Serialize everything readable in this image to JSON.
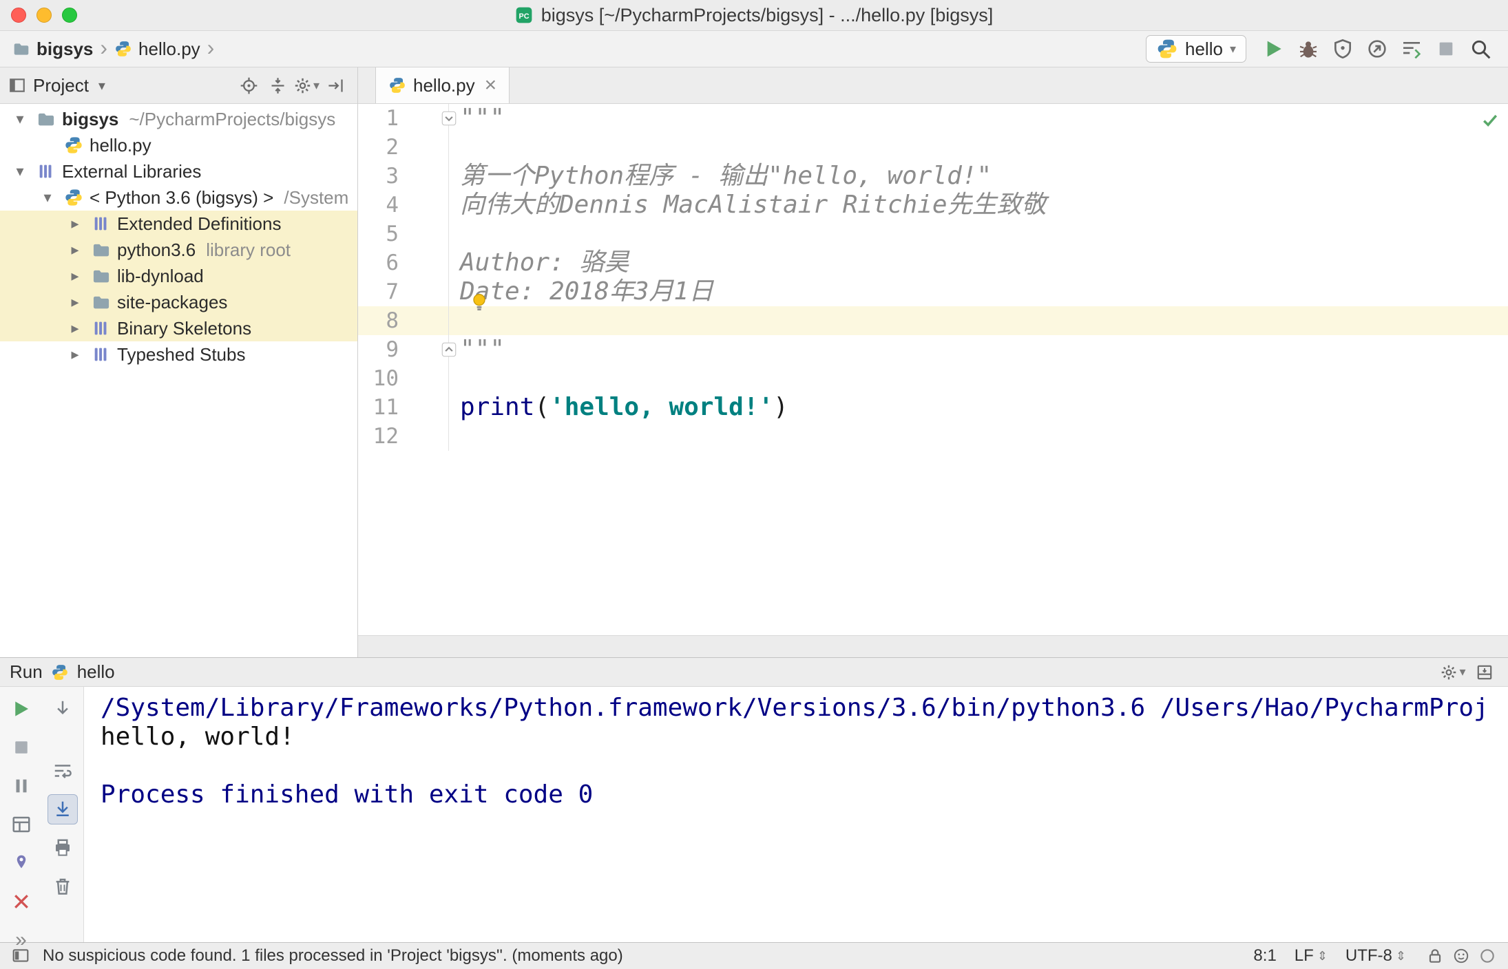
{
  "colors": {
    "accent_green": "#59a869",
    "console_system_blue": "#000084",
    "string_teal": "#008080",
    "keyword_blue": "#000080",
    "docstring_gray": "#8c8c8c",
    "highlight_yellow": "#f9f2cc",
    "python_blue": "#4584b6",
    "python_yellow": "#ffd43b"
  },
  "titlebar": {
    "title": "bigsys [~/PycharmProjects/bigsys] - .../hello.py [bigsys]",
    "app_icon": "pycharm"
  },
  "navbar": {
    "breadcrumbs": [
      {
        "label": "bigsys",
        "icon": "folder",
        "bold": true
      },
      {
        "label": "hello.py",
        "icon": "python",
        "bold": false
      }
    ],
    "run_config": {
      "label": "hello",
      "icon": "python"
    },
    "actions": [
      {
        "name": "run-button",
        "icon": "play"
      },
      {
        "name": "debug-button",
        "icon": "bug"
      },
      {
        "name": "run-with-coverage-button",
        "icon": "coverage"
      },
      {
        "name": "profiler-button",
        "icon": "profiler"
      },
      {
        "name": "thread-dump-button",
        "icon": "threads"
      },
      {
        "name": "stop-button",
        "icon": "stop"
      },
      {
        "name": "search-everywhere-button",
        "icon": "search"
      }
    ]
  },
  "project_panel": {
    "title": "Project",
    "tool_icon": "tool-window",
    "actions": [
      {
        "name": "locate-file-button",
        "icon": "target"
      },
      {
        "name": "collapse-all-button",
        "icon": "collapse"
      },
      {
        "name": "settings-button",
        "icon": "gear",
        "dropdown": true
      },
      {
        "name": "hide-panel-button",
        "icon": "hide"
      }
    ],
    "tree": [
      {
        "label": "bigsys",
        "hint": "~/PycharmProjects/bigsys",
        "icon": "folder",
        "expand": "open",
        "bold": true,
        "level": 0
      },
      {
        "label": "hello.py",
        "icon": "python",
        "expand": "none",
        "level": 1
      },
      {
        "label": "External Libraries",
        "icon": "library",
        "expand": "open",
        "level": 0
      },
      {
        "label": "< Python 3.6 (bigsys) >",
        "hint": "/System",
        "icon": "python",
        "expand": "open",
        "level": 1
      },
      {
        "label": "Extended Definitions",
        "icon": "library",
        "expand": "closed",
        "level": 2,
        "highlight": true
      },
      {
        "label": "python3.6",
        "hint": "library root",
        "icon": "folder",
        "expand": "closed",
        "level": 2,
        "highlight": true
      },
      {
        "label": "lib-dynload",
        "icon": "folder",
        "expand": "closed",
        "level": 2,
        "highlight": true
      },
      {
        "label": "site-packages",
        "icon": "folder",
        "expand": "closed",
        "level": 2,
        "highlight": true
      },
      {
        "label": "Binary Skeletons",
        "icon": "library",
        "expand": "closed",
        "level": 2,
        "highlight": true
      },
      {
        "label": "Typeshed Stubs",
        "icon": "library",
        "expand": "closed",
        "level": 2,
        "highlight": false
      }
    ]
  },
  "editor": {
    "tab": {
      "label": "hello.py",
      "icon": "python"
    },
    "overlays": {
      "inspection_icon": "check",
      "intention_bulb_icon": "bulb",
      "fold_top_icon": "fold-down",
      "fold_bottom_icon": "fold-up"
    },
    "lines": [
      {
        "num": 1,
        "segments": [
          {
            "t": "\"\"\"",
            "c": "doc"
          }
        ]
      },
      {
        "num": 2,
        "segments": []
      },
      {
        "num": 3,
        "segments": [
          {
            "t": "第一个Python程序 - 输出\"hello, world!\"",
            "c": "doc"
          }
        ]
      },
      {
        "num": 4,
        "segments": [
          {
            "t": "向伟大的Dennis MacAlistair Ritchie先生致敬",
            "c": "doc"
          }
        ]
      },
      {
        "num": 5,
        "segments": []
      },
      {
        "num": 6,
        "segments": [
          {
            "t": "Author: 骆昊",
            "c": "doc"
          }
        ]
      },
      {
        "num": 7,
        "segments": [
          {
            "t": "Date: 2018年3月1日",
            "c": "doc"
          }
        ]
      },
      {
        "num": 8,
        "segments": [],
        "current": true
      },
      {
        "num": 9,
        "segments": [
          {
            "t": "\"\"\"",
            "c": "doc"
          }
        ]
      },
      {
        "num": 10,
        "segments": []
      },
      {
        "num": 11,
        "segments": [
          {
            "t": "print",
            "c": "kw"
          },
          {
            "t": "(",
            "c": "plain"
          },
          {
            "t": "'hello, world!'",
            "c": "str"
          },
          {
            "t": ")",
            "c": "plain"
          }
        ]
      },
      {
        "num": 12,
        "segments": []
      }
    ]
  },
  "run_panel": {
    "title": "Run",
    "config": {
      "label": "hello",
      "icon": "python"
    },
    "header_actions": [
      {
        "name": "run-settings-button",
        "icon": "gear",
        "dropdown": true
      },
      {
        "name": "dock-panel-button",
        "icon": "dock"
      }
    ],
    "toolbar_main": [
      {
        "name": "rerun-button",
        "icon": "play"
      },
      {
        "name": "stop-process-button",
        "icon": "stop"
      },
      {
        "name": "pause-output-button",
        "icon": "pause"
      },
      {
        "name": "restore-layout-button",
        "icon": "layout"
      },
      {
        "name": "pin-tab-button",
        "icon": "pin"
      },
      {
        "name": "close-tab-button",
        "icon": "close"
      },
      {
        "name": "more-options-button",
        "icon": "chevrons"
      }
    ],
    "toolbar_console": [
      {
        "name": "down-stack-trace-button",
        "icon": "down-arrow"
      },
      {
        "name": "soft-wrap-button",
        "icon": "softwrap"
      },
      {
        "name": "scroll-to-end-button",
        "icon": "scrollend",
        "pressed": true
      },
      {
        "name": "print-console-button",
        "icon": "printer"
      },
      {
        "name": "clear-all-button",
        "icon": "trash"
      }
    ],
    "console": [
      {
        "t": "/System/Library/Frameworks/Python.framework/Versions/3.6/bin/python3.6 /Users/Hao/PycharmProj",
        "c": "sys"
      },
      {
        "t": "hello, world!",
        "c": "out"
      },
      {
        "t": "",
        "c": "out"
      },
      {
        "t": "Process finished with exit code 0",
        "c": "sys"
      }
    ]
  },
  "statusbar": {
    "switcher_icon": "monitor",
    "message": "No suspicious code found. 1 files processed in 'Project 'bigsys''. (moments ago)",
    "caret_position": "8:1",
    "line_separator": "LF",
    "encoding": "UTF-8",
    "icons": [
      {
        "name": "readonly-lock-button",
        "icon": "lock"
      },
      {
        "name": "hector-inspector-button",
        "icon": "smiley"
      },
      {
        "name": "indicator-button",
        "icon": "circle"
      }
    ]
  }
}
